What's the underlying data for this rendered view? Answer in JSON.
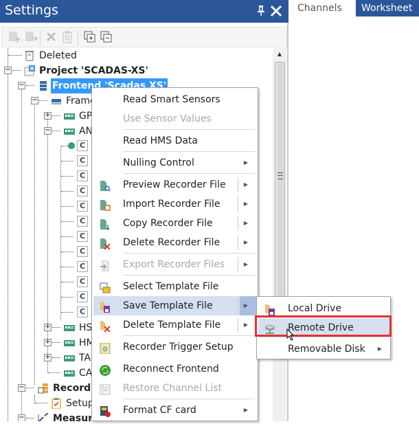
{
  "settings_pane": {
    "title": "Settings",
    "pin_icon": "pin-icon",
    "close_icon": "close-icon",
    "toolbar": [
      {
        "icon": "upload-db-icon",
        "enabled": false
      },
      {
        "icon": "export-db-icon",
        "enabled": false
      },
      {
        "icon": "delete-icon",
        "enabled": false
      },
      {
        "icon": "paste-icon",
        "enabled": false
      },
      {
        "icon": "expand-all-icon",
        "enabled": true
      },
      {
        "icon": "collapse-all-icon",
        "enabled": true
      }
    ]
  },
  "tabs": [
    {
      "label": "Channels",
      "active": false
    },
    {
      "label": "Worksheet",
      "active": true
    }
  ],
  "tree": {
    "deleted": "Deleted",
    "project": "Project 'SCADAS-XS'",
    "frontend": "Frontend 'Scadas XS'",
    "frame": "Frame",
    "gp": "GP",
    "an": "AN",
    "channel_letter": "C",
    "hs": "HS",
    "hm": "HM",
    "ta": "TA",
    "ca": "CA",
    "recorder": "Recorde",
    "setup": "Setup",
    "measure": "Measure"
  },
  "context_menu": {
    "items": [
      {
        "label": "Read Smart Sensors",
        "enabled": true,
        "submenu": false,
        "icon": ""
      },
      {
        "label": "Use Sensor Values",
        "enabled": false,
        "submenu": false,
        "icon": ""
      },
      {
        "label": "Read HMS Data",
        "enabled": true,
        "submenu": false,
        "icon": ""
      },
      {
        "label": "Nulling Control",
        "enabled": true,
        "submenu": true,
        "icon": ""
      },
      {
        "label": "Preview Recorder File",
        "enabled": true,
        "submenu": true,
        "icon": "preview-file-icon"
      },
      {
        "label": "Import Recorder File",
        "enabled": true,
        "submenu": true,
        "icon": "import-file-icon"
      },
      {
        "label": "Copy Recorder File",
        "enabled": true,
        "submenu": true,
        "icon": "copy-file-icon"
      },
      {
        "label": "Delete Recorder File",
        "enabled": true,
        "submenu": true,
        "icon": "delete-file-icon"
      },
      {
        "label": "Export Recorder Files",
        "enabled": false,
        "submenu": true,
        "icon": "export-files-icon"
      },
      {
        "label": "Select Template File",
        "enabled": true,
        "submenu": false,
        "icon": "select-template-icon"
      },
      {
        "label": "Save Template File",
        "enabled": true,
        "submenu": true,
        "icon": "save-template-icon",
        "highlighted": true
      },
      {
        "label": "Delete Template File",
        "enabled": true,
        "submenu": true,
        "icon": "delete-template-icon"
      },
      {
        "label": "Recorder Trigger Setup",
        "enabled": true,
        "submenu": false,
        "icon": "trigger-setup-icon"
      },
      {
        "label": "Reconnect Frontend",
        "enabled": true,
        "submenu": false,
        "icon": "reconnect-icon"
      },
      {
        "label": "Restore Channel List",
        "enabled": false,
        "submenu": false,
        "icon": "restore-list-icon"
      },
      {
        "label": "Format CF card",
        "enabled": true,
        "submenu": true,
        "icon": "format-card-icon"
      }
    ]
  },
  "submenu": {
    "items": [
      {
        "label": "Local Drive",
        "icon": "local-drive-icon",
        "submenu": false
      },
      {
        "label": "Remote Drive",
        "icon": "remote-drive-icon",
        "submenu": false,
        "highlighted": true
      },
      {
        "label": "Removable Disk",
        "icon": "",
        "submenu": true
      }
    ]
  },
  "colors": {
    "title_bar": "#2b579a",
    "selection": "#3399ff",
    "menu_highlight": "#d5dfef",
    "callout_border": "#e53030"
  }
}
